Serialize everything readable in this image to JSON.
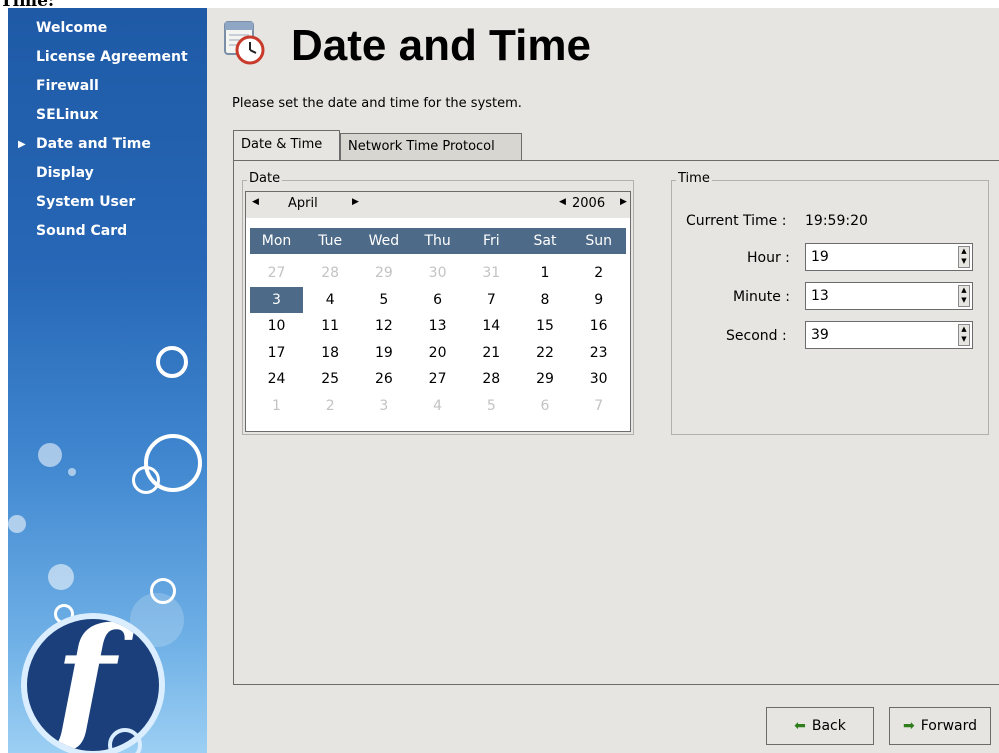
{
  "top_cut_text": "Time:",
  "sidebar": {
    "items": [
      {
        "label": "Welcome",
        "current": false
      },
      {
        "label": "License Agreement",
        "current": false
      },
      {
        "label": "Firewall",
        "current": false
      },
      {
        "label": "SELinux",
        "current": false
      },
      {
        "label": "Date and Time",
        "current": true
      },
      {
        "label": "Display",
        "current": false
      },
      {
        "label": "System User",
        "current": false
      },
      {
        "label": "Sound Card",
        "current": false
      }
    ],
    "logo_icon": "fedora-logo"
  },
  "header": {
    "icon": "calendar-clock-icon",
    "title": "Date and Time",
    "instructions": "Please set the date and time for the system."
  },
  "tabs": [
    {
      "label": "Date & Time",
      "active": true
    },
    {
      "label": "Network Time Protocol",
      "active": false
    }
  ],
  "date": {
    "frame_label": "Date",
    "month": "April",
    "year": "2006",
    "weekdays": [
      "Mon",
      "Tue",
      "Wed",
      "Thu",
      "Fri",
      "Sat",
      "Sun"
    ],
    "weeks": [
      [
        "27",
        "28",
        "29",
        "30",
        "31",
        "1",
        "2"
      ],
      [
        "3",
        "4",
        "5",
        "6",
        "7",
        "8",
        "9"
      ],
      [
        "10",
        "11",
        "12",
        "13",
        "14",
        "15",
        "16"
      ],
      [
        "17",
        "18",
        "19",
        "20",
        "21",
        "22",
        "23"
      ],
      [
        "24",
        "25",
        "26",
        "27",
        "28",
        "29",
        "30"
      ],
      [
        "1",
        "2",
        "3",
        "4",
        "5",
        "6",
        "7"
      ]
    ],
    "selected": "3"
  },
  "time": {
    "frame_label": "Time",
    "current_label": "Current Time :",
    "current_value": "19:59:20",
    "hour_label": "Hour :",
    "hour_value": "19",
    "minute_label": "Minute :",
    "minute_value": "13",
    "second_label": "Second :",
    "second_value": "39"
  },
  "buttons": {
    "back": "Back",
    "forward": "Forward"
  },
  "colors": {
    "sidebar_top": "#1e5aa6",
    "sidebar_bottom": "#9ccff3",
    "calendar_header": "#4d6a88",
    "window_bg": "#e6e5e1",
    "button_arrow": "#2f7d1b"
  }
}
